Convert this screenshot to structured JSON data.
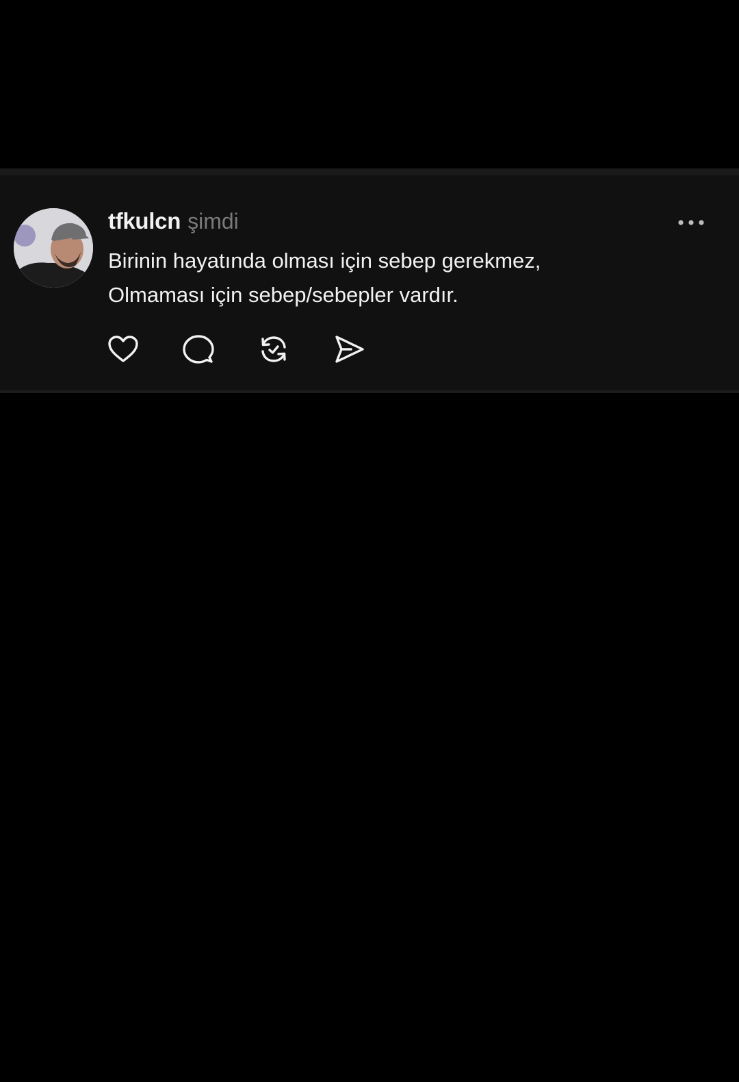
{
  "post": {
    "username": "tfkulcn",
    "timestamp": "şimdi",
    "text_lines": [
      "Birinin hayatında olması için sebep gerekmez,",
      "Olmaması için sebep/sebepler vardır."
    ],
    "avatar_icon": "profile-photo",
    "more_icon": "more-horizontal-icon",
    "actions": [
      {
        "icon": "heart-icon"
      },
      {
        "icon": "comment-icon"
      },
      {
        "icon": "repost-icon"
      },
      {
        "icon": "share-icon"
      }
    ]
  },
  "colors": {
    "background": "#000000",
    "card": "#111111",
    "text": "#f2f2f2",
    "muted": "#7a7a7a"
  }
}
